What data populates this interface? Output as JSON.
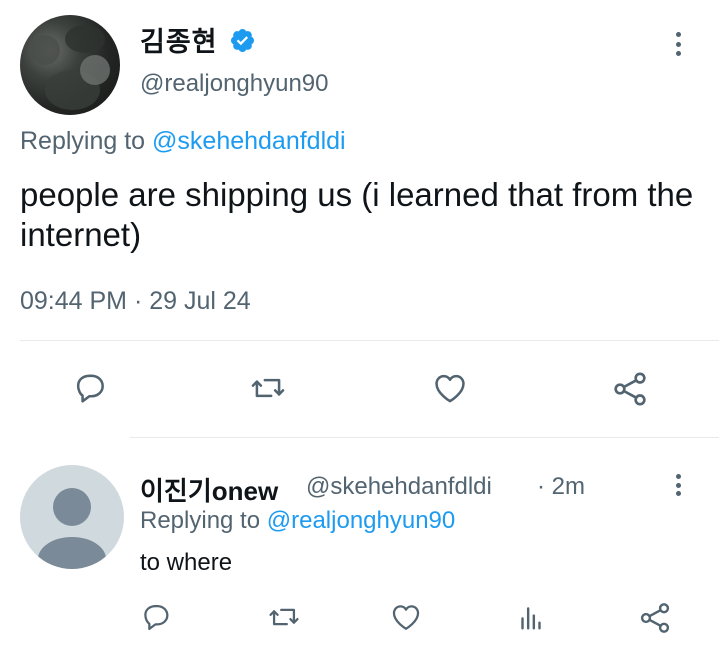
{
  "main_tweet": {
    "author_name": "김종현",
    "author_handle": "@realjonghyun90",
    "replying_prefix": "Replying to ",
    "replying_to": "@skehehdanfdldi",
    "text": "people are shipping us (i learned that from the internet)",
    "timestamp": "09:44 PM · 29 Jul 24",
    "verified": true,
    "actions": [
      "reply-icon",
      "retweet-icon",
      "like-icon",
      "share-icon"
    ]
  },
  "reply_tweet": {
    "author_name": "이진기onew",
    "author_handle": "@skehehdanfdldi",
    "time": "· 2m",
    "replying_prefix": "Replying to ",
    "replying_to": "@realjonghyun90",
    "text": "to where",
    "actions": [
      "reply-icon",
      "retweet-icon",
      "like-icon",
      "views-icon",
      "share-icon"
    ]
  },
  "colors": {
    "accent": "#1d9bf0",
    "secondary_text": "#536471",
    "primary_text": "#0f1419",
    "divider": "#e7e9ea",
    "icon": "#536471"
  }
}
